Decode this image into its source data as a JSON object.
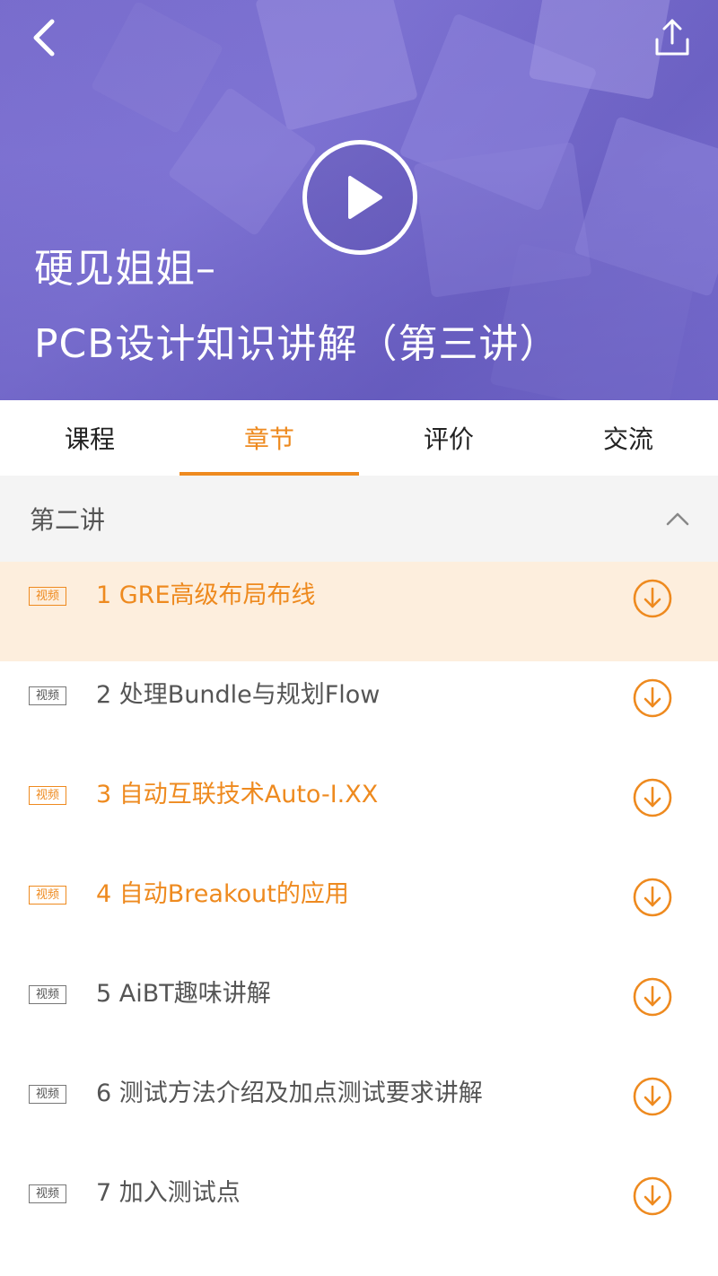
{
  "colors": {
    "accent": "#ee8a1f",
    "hero": "#7b6fcf",
    "muted": "#555555"
  },
  "header": {
    "back_icon": "chevron-left-icon",
    "share_icon": "share-upload-icon",
    "play_icon": "play-icon",
    "title_line1": "硬见姐姐–",
    "title_line2": "PCB设计知识讲解（第三讲）"
  },
  "tabs": [
    {
      "label": "课程",
      "active": false
    },
    {
      "label": "章节",
      "active": true
    },
    {
      "label": "评价",
      "active": false
    },
    {
      "label": "交流",
      "active": false
    }
  ],
  "section": {
    "title": "第二讲",
    "toggle_icon": "chevron-up-icon"
  },
  "lessons": [
    {
      "tag": "视频",
      "title": "1 GRE高级布局布线",
      "highlight": true,
      "state": "current"
    },
    {
      "tag": "视频",
      "title": "2 处理Bundle与规划Flow",
      "highlight": false
    },
    {
      "tag": "视频",
      "title": "3 自动互联技术Auto-I.XX",
      "highlight": true
    },
    {
      "tag": "视频",
      "title": "4 自动Breakout的应用",
      "highlight": true
    },
    {
      "tag": "视频",
      "title": "5 AiBT趣味讲解",
      "highlight": false
    },
    {
      "tag": "视频",
      "title": "6 测试方法介绍及加点测试要求讲解",
      "highlight": false
    },
    {
      "tag": "视频",
      "title": "7 加入测试点",
      "highlight": false
    }
  ],
  "download_icon": "download-circle-icon"
}
